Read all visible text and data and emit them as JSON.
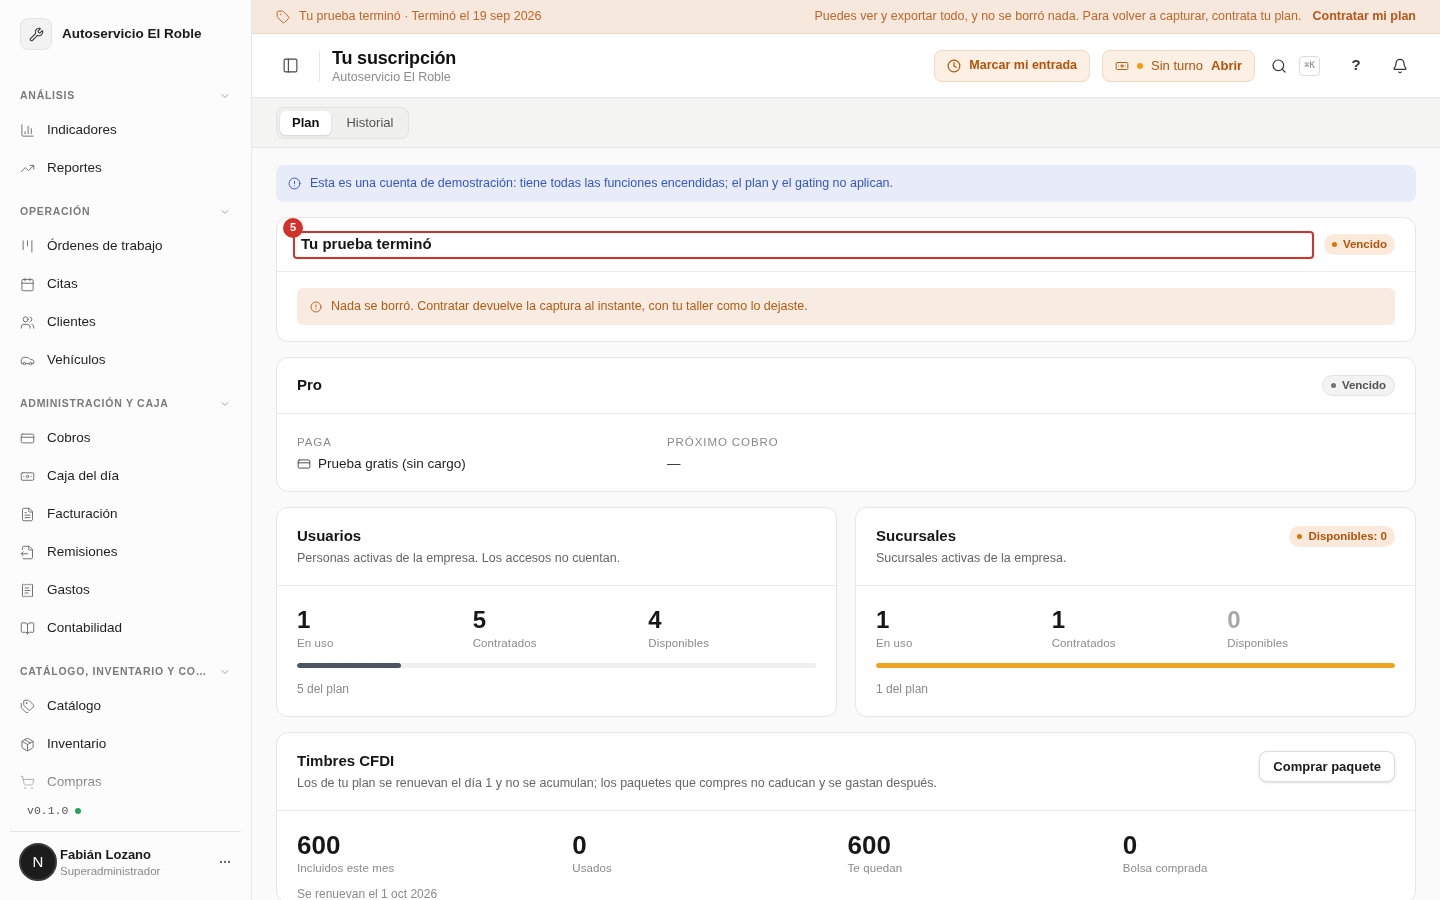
{
  "sidebar": {
    "brand": "Autoservicio El Roble",
    "sections": [
      {
        "title": "ANÁLISIS",
        "expanded": true,
        "items": [
          {
            "label": "Indicadores",
            "selected": false
          },
          {
            "label": "Reportes",
            "selected": false
          }
        ]
      },
      {
        "title": "OPERACIÓN",
        "expanded": true,
        "items": [
          {
            "label": "Órdenes de trabajo",
            "selected": false
          },
          {
            "label": "Citas",
            "selected": false
          },
          {
            "label": "Clientes",
            "selected": false
          },
          {
            "label": "Vehículos",
            "selected": false
          }
        ]
      },
      {
        "title": "ADMINISTRACIÓN Y CAJA",
        "expanded": true,
        "items": [
          {
            "label": "Cobros",
            "selected": false
          },
          {
            "label": "Caja del día",
            "selected": false
          },
          {
            "label": "Facturación",
            "selected": false
          },
          {
            "label": "Remisiones",
            "selected": false
          },
          {
            "label": "Gastos",
            "selected": false
          },
          {
            "label": "Contabilidad",
            "selected": false
          }
        ]
      },
      {
        "title": "CATÁLOGO, INVENTARIO Y CO…",
        "expanded": true,
        "items": [
          {
            "label": "Catálogo",
            "selected": false
          },
          {
            "label": "Inventario",
            "selected": false
          },
          {
            "label": "Compras",
            "selected": false
          }
        ]
      }
    ],
    "version": "v0.1.0",
    "user": {
      "badge": "N",
      "name": "Fabián Lozano",
      "role": "Superadministrador"
    }
  },
  "trial_banner": {
    "status": "Tu prueba terminó · Terminó el 19 sep 2026",
    "message": "Puedes ver y exportar todo, y no se borró nada. Para volver a capturar, contrata tu plan.",
    "action": "Contratar mi plan"
  },
  "header": {
    "title": "Tu suscripción",
    "subtitle": "Autoservicio El Roble",
    "clock_in": "Marcar mi entrada",
    "shift": {
      "status": "Sin turno",
      "action": "Abrir"
    },
    "shortcut": "⌘K",
    "help": "?"
  },
  "tabs": [
    {
      "label": "Plan",
      "selected": true
    },
    {
      "label": "Historial",
      "selected": false
    }
  ],
  "demo_notice": "Esta es una cuenta de demostración: tiene todas las funciones encendidas; el plan y el gating no aplican.",
  "trial_card": {
    "title": "Tu prueba terminó",
    "marker": "5",
    "badge": {
      "label": "Vencido",
      "kind": "warning"
    },
    "warning": "Nada se borró. Contratar devuelve la captura al instante, con tu taller como lo dejaste."
  },
  "plan_card": {
    "title": "Pro",
    "badge": {
      "label": "Vencido",
      "kind": "neutral"
    },
    "fields": [
      {
        "label": "PAGA",
        "value": "Prueba gratis (sin cargo)",
        "kind": "payment"
      },
      {
        "label": "PRÓXIMO COBRO",
        "value": "—",
        "kind": "text"
      }
    ]
  },
  "quota_cards": [
    {
      "title": "Usuarios",
      "description": "Personas activas de la empresa. Los accesos no cuentan.",
      "stats": [
        {
          "value": "1",
          "label": "En uso",
          "dimmed": false
        },
        {
          "value": "5",
          "label": "Contratados",
          "dimmed": false
        },
        {
          "value": "4",
          "label": "Disponibles",
          "dimmed": false
        }
      ],
      "meter": {
        "level": 0.2,
        "kind": "normal"
      },
      "footnote": "5 del plan"
    },
    {
      "title": "Sucursales",
      "description": "Sucursales activas de la empresa.",
      "badge": {
        "label": "Disponibles: 0",
        "kind": "warning"
      },
      "stats": [
        {
          "value": "1",
          "label": "En uso",
          "dimmed": false
        },
        {
          "value": "1",
          "label": "Contratados",
          "dimmed": false
        },
        {
          "value": "0",
          "label": "Disponibles",
          "dimmed": true
        }
      ],
      "meter": {
        "level": 1,
        "kind": "full"
      },
      "footnote": "1 del plan"
    }
  ],
  "stamps_card": {
    "title": "Timbres CFDI",
    "description": "Los de tu plan se renuevan el día 1 y no se acumulan; los paquetes que compres no caducan y se gastan después.",
    "button": "Comprar paquete",
    "stats": [
      {
        "value": "600",
        "label": "Incluidos este mes"
      },
      {
        "value": "0",
        "label": "Usados"
      },
      {
        "value": "600",
        "label": "Te quedan"
      },
      {
        "value": "0",
        "label": "Bolsa comprada"
      }
    ],
    "footnote": "Se renuevan el 1 oct 2026"
  }
}
